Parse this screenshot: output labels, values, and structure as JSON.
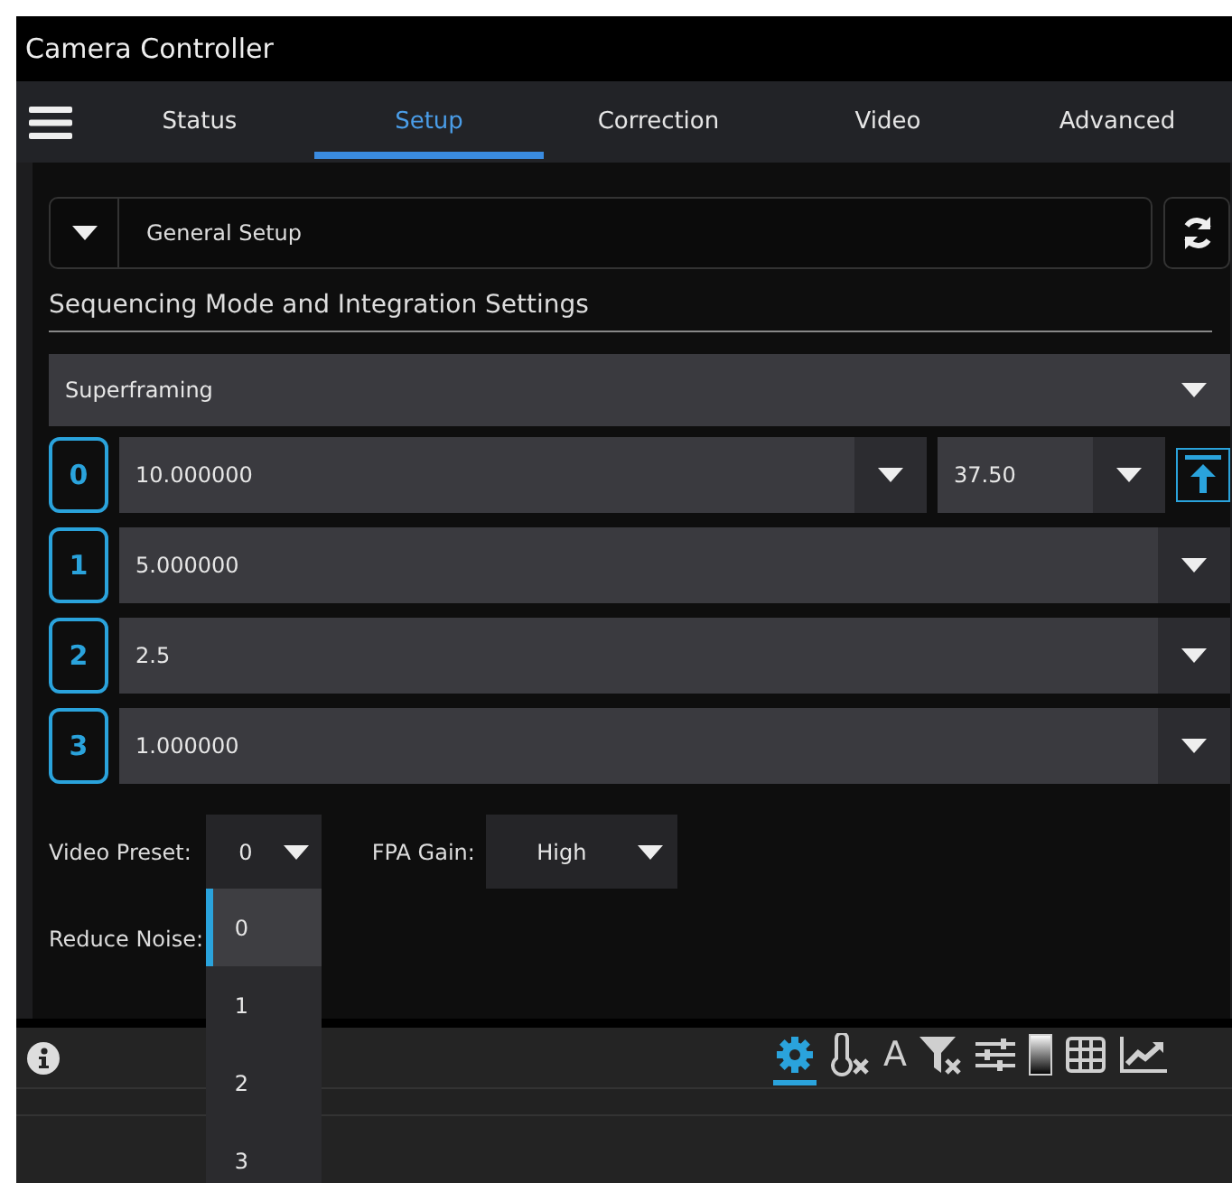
{
  "window": {
    "title": "Camera Controller"
  },
  "tabs": [
    {
      "label": "Status",
      "selected": false
    },
    {
      "label": "Setup",
      "selected": true
    },
    {
      "label": "Correction",
      "selected": false
    },
    {
      "label": "Video",
      "selected": false
    },
    {
      "label": "Advanced",
      "selected": false
    }
  ],
  "setup_selector": {
    "value": "General Setup"
  },
  "section": {
    "title": "Sequencing Mode and Integration Settings"
  },
  "mode_select": {
    "value": "Superframing"
  },
  "integration_rows": [
    {
      "index": "0",
      "value": "10.000000",
      "extra_value": "37.50"
    },
    {
      "index": "1",
      "value": "5.000000"
    },
    {
      "index": "2",
      "value": "2.5"
    },
    {
      "index": "3",
      "value": "1.000000"
    }
  ],
  "video_preset": {
    "label": "Video Preset:",
    "value": "0",
    "expanded": true,
    "options": [
      {
        "label": "0",
        "selected": true
      },
      {
        "label": "1",
        "selected": false
      },
      {
        "label": "2",
        "selected": false
      },
      {
        "label": "3",
        "selected": false
      }
    ]
  },
  "fpa_gain": {
    "label": "FPA Gain:",
    "value": "High"
  },
  "reduce_noise": {
    "label": "Reduce Noise:"
  },
  "toolbar": {
    "tools": [
      {
        "kind": "gear",
        "selected": true
      },
      {
        "kind": "thermometer-x",
        "selected": false
      },
      {
        "kind": "text",
        "label": "A",
        "selected": false
      },
      {
        "kind": "filter-x",
        "selected": false
      },
      {
        "kind": "sliders",
        "selected": false
      },
      {
        "kind": "gradient",
        "selected": false
      },
      {
        "kind": "table",
        "selected": false
      },
      {
        "kind": "chart",
        "selected": false
      }
    ]
  }
}
